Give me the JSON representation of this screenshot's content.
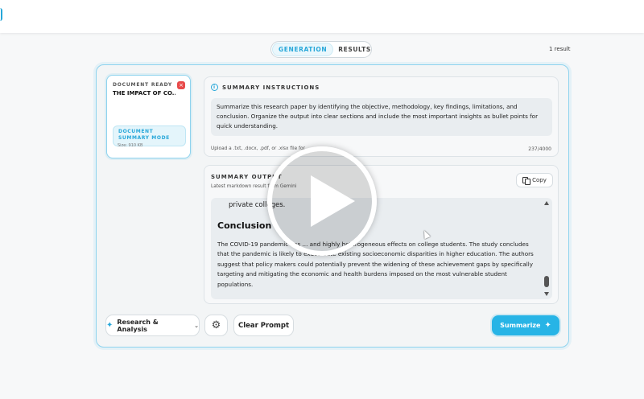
{
  "tabs": [
    {
      "label": "GENERATION",
      "active": true
    },
    {
      "label": "RESULTS",
      "active": false
    }
  ],
  "result_count": "1 result",
  "document": {
    "status": "DOCUMENT READY",
    "title": "THE IMPACT OF CO...",
    "close_icon": "×",
    "mode": "DOCUMENT SUMMARY MODE",
    "size": "Size: 910 KB"
  },
  "instructions": {
    "heading": "SUMMARY INSTRUCTIONS",
    "info_icon": "i",
    "text": "Summarize this research paper by identifying the objective, methodology, key findings, limitations, and conclusion. Organize the output into clear sections and include the most important insights as bullet points for quick understanding.",
    "upload_hint": "Upload a .txt, .docx, .pdf, or .xlsx file for ...",
    "char_count": "237/4000"
  },
  "output": {
    "heading": "SUMMARY OUTPUT",
    "subheading": "Latest markdown result from Gemini",
    "copy_label": "Copy",
    "fragment": "private colleges.",
    "section_title": "Conclusion",
    "paragraph": "The COVID-19 pandemic has ... and highly heterogeneous effects on college students. The study concludes that the pandemic is likely to exacerbate existing socioeconomic disparities in higher education. The authors suggest that policy makers could potentially prevent the widening of these achievement gaps by specifically targeting and mitigating the economic and health burdens imposed on the most vulnerable student populations."
  },
  "controls": {
    "category_label": "Research & Analysis",
    "sparkle_icon": "✦",
    "chevron_icon": "⌄",
    "settings_icon": "⚙",
    "clear_label": "Clear Prompt",
    "summarize_label": "Summarize"
  },
  "colors": {
    "accent": "#27a7d9",
    "summarize_button": "#27b4e6",
    "close_button": "#e84a4a"
  }
}
